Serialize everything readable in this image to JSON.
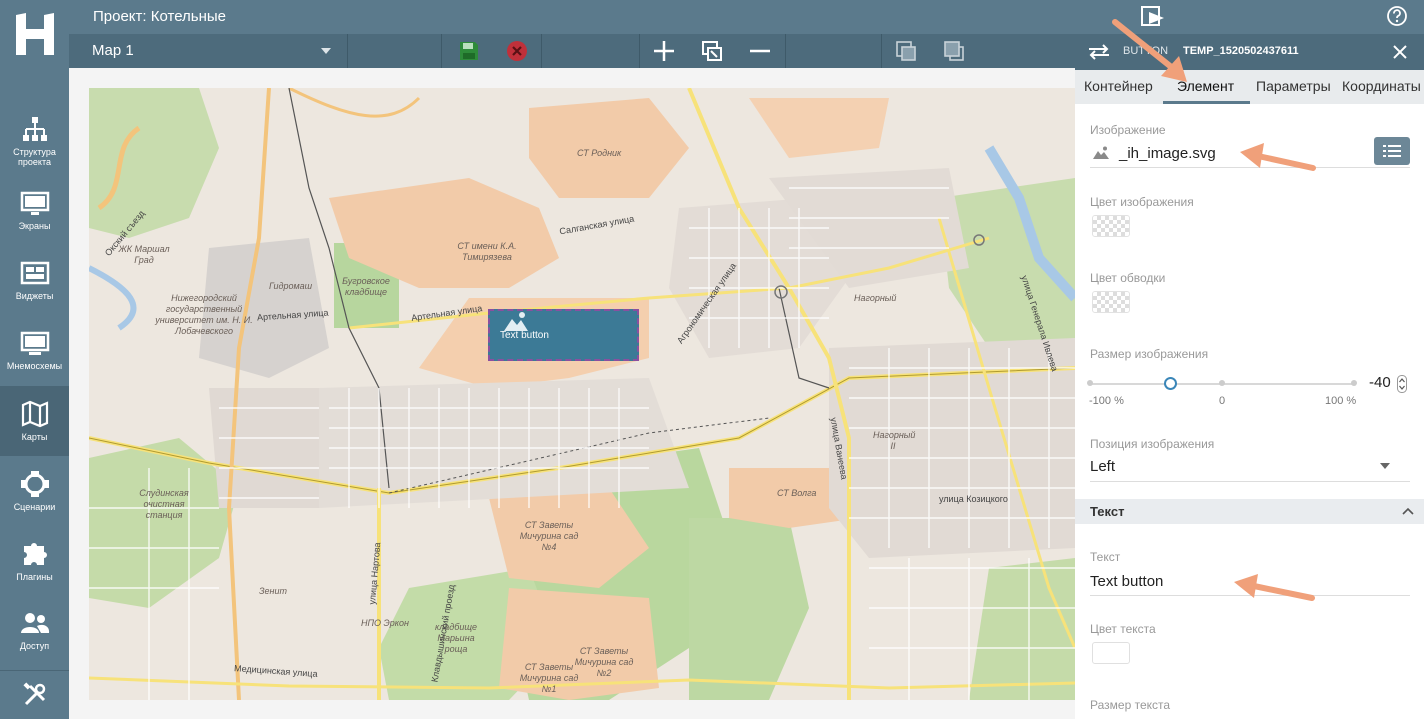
{
  "app": {
    "project_title": "Проект: Котельные"
  },
  "sidebar": {
    "items": [
      {
        "label": "Структура проекта",
        "icon": "structure-icon"
      },
      {
        "label": "Экраны",
        "icon": "monitor-icon"
      },
      {
        "label": "Виджеты",
        "icon": "widgets-icon"
      },
      {
        "label": "Мнемосхемы",
        "icon": "mnemo-icon"
      },
      {
        "label": "Карты",
        "icon": "map-icon",
        "active": true
      },
      {
        "label": "Сценарии",
        "icon": "scenarios-icon"
      },
      {
        "label": "Плагины",
        "icon": "plugins-icon"
      },
      {
        "label": "Доступ",
        "icon": "users-icon"
      },
      {
        "label": "",
        "icon": "tools-icon"
      }
    ]
  },
  "toolbar": {
    "map_name": "Map 1"
  },
  "map": {
    "labels": [
      "СТ Родник",
      "СТ имени К.А. Тимирязева",
      "Салганская улица",
      "ЖК Маршал Град",
      "Гидромаш",
      "Бугровское кладбище",
      "Нижегородский государственный университет им. Н. И. Лобачевского",
      "Артельная улица",
      "Артельная улица",
      "Агрономическая улица",
      "Нагорный",
      "Нагорный II",
      "улица Ванеева",
      "улица Генерала Ивлева",
      "СТ Волга",
      "Слудинская очистная станция",
      "СТ Заветы Мичурина сад №4",
      "улица Козицкого",
      "Зенит",
      "НПО Эркон",
      "кладбище Марьина роща",
      "СТ Заветы Мичурина сад №2",
      "СТ Заветы Мичурина сад №1",
      "Медицинская улица",
      "Клавдышинский проезд",
      "улица Нартова",
      "Окский съезд"
    ],
    "widget": {
      "text": "Text button",
      "icon": "image-icon"
    }
  },
  "panel": {
    "type": "BUTTON",
    "id": "TEMP_1520502437611",
    "tabs": [
      "Контейнер",
      "Элемент",
      "Параметры",
      "Координаты"
    ],
    "active_tab": "Элемент",
    "image_label": "Изображение",
    "image_value": "_ih_image.svg",
    "image_color_label": "Цвет изображения",
    "stroke_color_label": "Цвет обводки",
    "image_size_label": "Размер изображения",
    "image_size_value": "-40",
    "image_size_fraction": 0.3,
    "slider_min": "-100 %",
    "slider_mid": "0",
    "slider_max": "100 %",
    "image_pos_label": "Позиция изображения",
    "image_pos_value": "Left",
    "text_section": "Текст",
    "text_label": "Текст",
    "text_value": "Text button",
    "text_color_label": "Цвет текста",
    "text_size_label": "Размер текста"
  },
  "colors": {
    "chrome": "#5b7a8c",
    "accent": "#3a86b8",
    "annotation_arrow": "#f0a07a",
    "widget_fill": "#3c7a96",
    "save_green": "#2e8b3a",
    "cancel_red": "#c0303a"
  }
}
